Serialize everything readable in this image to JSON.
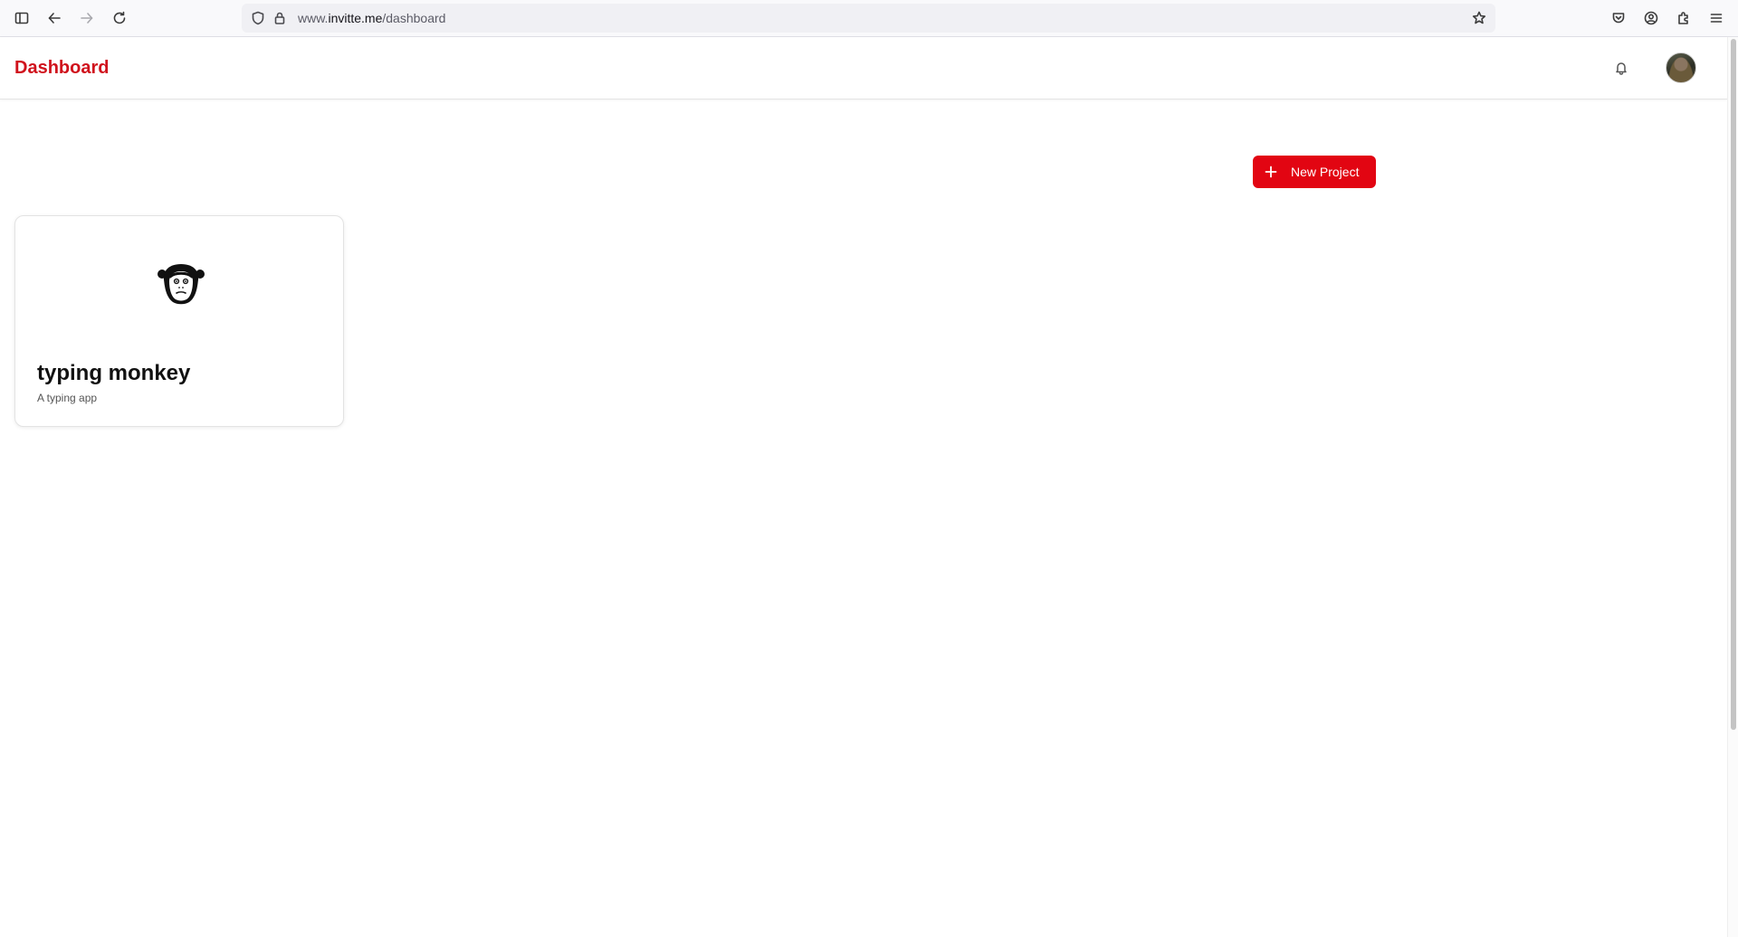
{
  "browser": {
    "url_prefix": "www.",
    "url_host": "invitte.me",
    "url_path": "/dashboard"
  },
  "header": {
    "title": "Dashboard"
  },
  "toolbar": {
    "new_project_label": "New Project"
  },
  "projects": [
    {
      "title": "typing monkey",
      "description": "A typing app",
      "icon": "monkey-icon"
    }
  ],
  "colors": {
    "brand": "#d0121c",
    "button": "#e20512"
  }
}
